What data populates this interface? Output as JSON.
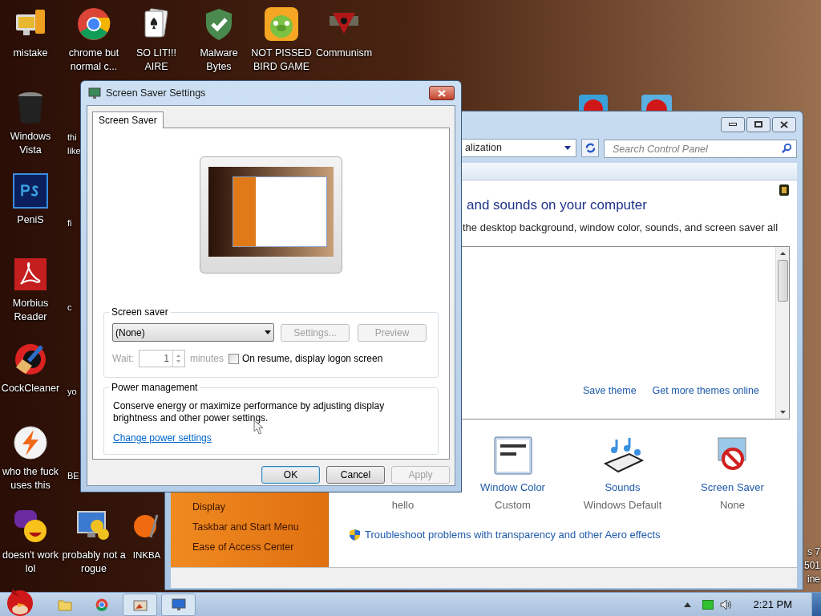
{
  "desktop_icons": [
    {
      "label": "mistake"
    },
    {
      "label": "chrome but normal c..."
    },
    {
      "label": "SO LIT!!! AIRE"
    },
    {
      "label": "Malware Bytes"
    },
    {
      "label": "NOT PISSED BIRD GAME"
    },
    {
      "label": "Communism"
    },
    {
      "label": "Windows Vista"
    },
    {
      "label": "PeniS"
    },
    {
      "label": "Morbius Reader"
    },
    {
      "label": "CockCleaner"
    },
    {
      "label": "who the fuck uses this"
    },
    {
      "label": "doesn't work lol"
    },
    {
      "label": "probably not a rogue"
    },
    {
      "label": "INKBA"
    }
  ],
  "desktop_cut_labels": [
    "thi like",
    "fi",
    "c",
    "yo",
    "BE"
  ],
  "desktop_corner_text": [
    "s 7",
    "501",
    "ine"
  ],
  "screen_saver_dialog": {
    "title": "Screen Saver Settings",
    "tabs": [
      {
        "label": "Screen Saver",
        "selected": true
      }
    ],
    "screen_saver_group": {
      "title": "Screen saver",
      "dropdown_value": "(None)",
      "buttons": [
        {
          "label": "Settings...",
          "disabled": true
        },
        {
          "label": "Preview",
          "disabled": true
        }
      ],
      "wait_label": "Wait:",
      "wait_value": "1",
      "wait_unit": "minutes",
      "wait_disabled": true,
      "logon_checkbox": {
        "label": "On resume, display logon screen",
        "checked": false
      }
    },
    "power_group": {
      "title": "Power management",
      "text": "Conserve energy or maximize performance by adjusting display brightness and other power settings.",
      "link": "Change power settings"
    },
    "buttons": [
      {
        "label": "OK",
        "default": true,
        "disabled": false
      },
      {
        "label": "Cancel",
        "default": false,
        "disabled": false
      },
      {
        "label": "Apply",
        "default": false,
        "disabled": true
      }
    ]
  },
  "control_panel": {
    "address": "alization",
    "search_placeholder": "Search Control Panel",
    "heading": "and sounds on your computer",
    "description": "the desktop background, window color, sounds, and screen saver all",
    "theme_links": [
      "Save theme",
      "Get more themes online"
    ],
    "sidebar_links": [
      "Display",
      "Taskbar and Start Menu",
      "Ease of Access Center"
    ],
    "settings": [
      {
        "subtitle": "hello"
      },
      {
        "label": "Window Color",
        "subtitle": "Custom"
      },
      {
        "label": "Sounds",
        "subtitle": "Windows Default"
      },
      {
        "label": "Screen Saver",
        "subtitle": "None"
      }
    ],
    "troubleshoot_link": "Troubleshoot problems with transparency and other Aero effects"
  },
  "taskbar": {
    "clock": "2:21 PM"
  }
}
